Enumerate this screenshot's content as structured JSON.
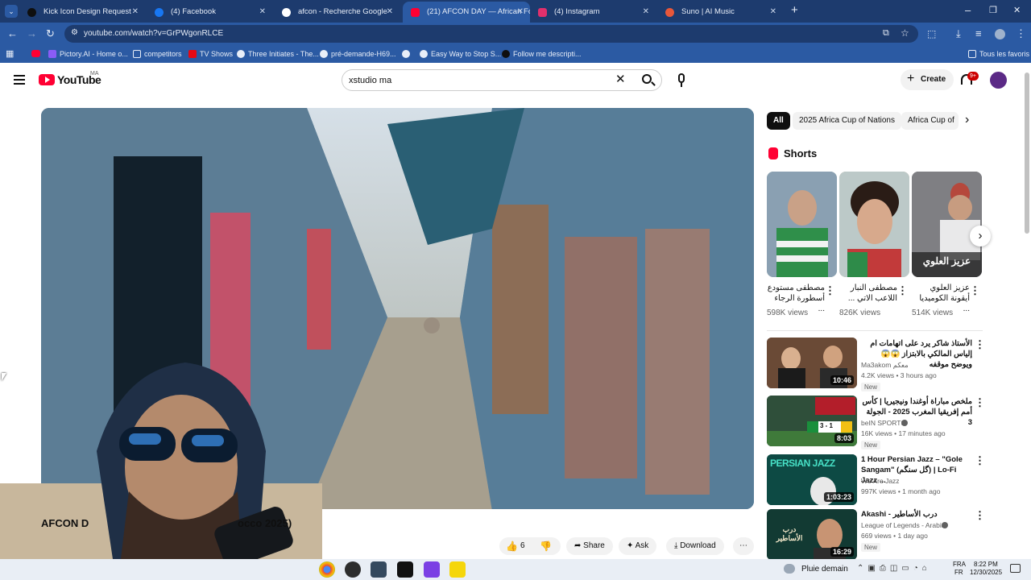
{
  "tabs": [
    {
      "title": "Kick Icon Design Request",
      "color": "#0f0f0f"
    },
    {
      "title": "(4) Facebook",
      "color": "#1877f2"
    },
    {
      "title": "afcon - Recherche Google",
      "color": "#ffffff"
    },
    {
      "title": "(21) AFCON DAY — African Foo",
      "color": "#ff0033"
    },
    {
      "title": "(4) Instagram",
      "color": "#e1306c"
    },
    {
      "title": "Suno | AI Music",
      "color": "#e8573a"
    }
  ],
  "address": "youtube.com/watch?v=GrPWgonRLCE",
  "bookmarks": [
    {
      "label": "Pictory.AI - Home o..."
    },
    {
      "label": "competitors"
    },
    {
      "label": "TV Shows"
    },
    {
      "label": "Three Initiates - The..."
    },
    {
      "label": "pré-demande-H69..."
    },
    {
      "label": "Easy Way to Stop S..."
    },
    {
      "label": "Follow me descripti..."
    },
    {
      "label": "Tous les favoris"
    }
  ],
  "youtube": {
    "logo": "YouTube",
    "region": "MA",
    "search_value": "xstudio ma",
    "create_label": "Create",
    "notif_count": "9+"
  },
  "chips": [
    "All",
    "2025 Africa Cup of Nations",
    "Africa Cup of"
  ],
  "shorts_heading": "Shorts",
  "shorts": [
    {
      "title": "مصطفى مستودع أسطورة الرجاء ...",
      "views": "598K views",
      "overlay": ""
    },
    {
      "title": "مصطفى النبار اللاعب الاتي ...",
      "views": "826K views",
      "overlay": ""
    },
    {
      "title": "عزيز العلوي أيقونة الكوميديا ...",
      "views": "514K views",
      "overlay": "عزيز العلوي"
    }
  ],
  "videos": [
    {
      "title": "الأستاذ شاكر يرد على اتهامات ام إلياس المالكي بالابتزاز 😱😱 ويوضح موقفه",
      "channel": "Ma3akom معكم",
      "meta": "4.2K views • 3 hours ago",
      "badge": "New",
      "duration": "10:46"
    },
    {
      "title": "ملخص مباراة أوغندا ونيجيريا | كأس أمم إفريقيا المغرب 2025 - الجولة 3",
      "channel": "beIN SPORTS",
      "meta": "16K views • 17 minutes ago",
      "badge": "New",
      "duration": "8:03"
    },
    {
      "title": "1 Hour Persian Jazz – \"Gole Sangam\" (گل سنگم) | Lo-Fi Jazz ...",
      "channel": "We Are Jazz",
      "meta": "997K views • 1 month ago",
      "badge": "",
      "duration": "1:03:23"
    },
    {
      "title": "Akashi - درب الأساطير",
      "channel": "League of Legends - Arabia",
      "meta": "669 views • 1 day ago",
      "badge": "New",
      "duration": "16:29"
    }
  ],
  "video_title_left": "AFCON D",
  "video_title_right": "occo 2025)",
  "actions": {
    "likes": "6",
    "share": "Share",
    "ask": "Ask",
    "download": "Download"
  },
  "thumb_texts": {
    "t1": "10:46",
    "persian": "PERSIAN JAZZ",
    "derb": "درب الأساطير",
    "score": "3 - 1"
  },
  "taskbar": {
    "weather": "Pluie demain",
    "lang1": "FRA",
    "lang2": "FR",
    "time": "8:22 PM",
    "date": "12/30/2025"
  }
}
